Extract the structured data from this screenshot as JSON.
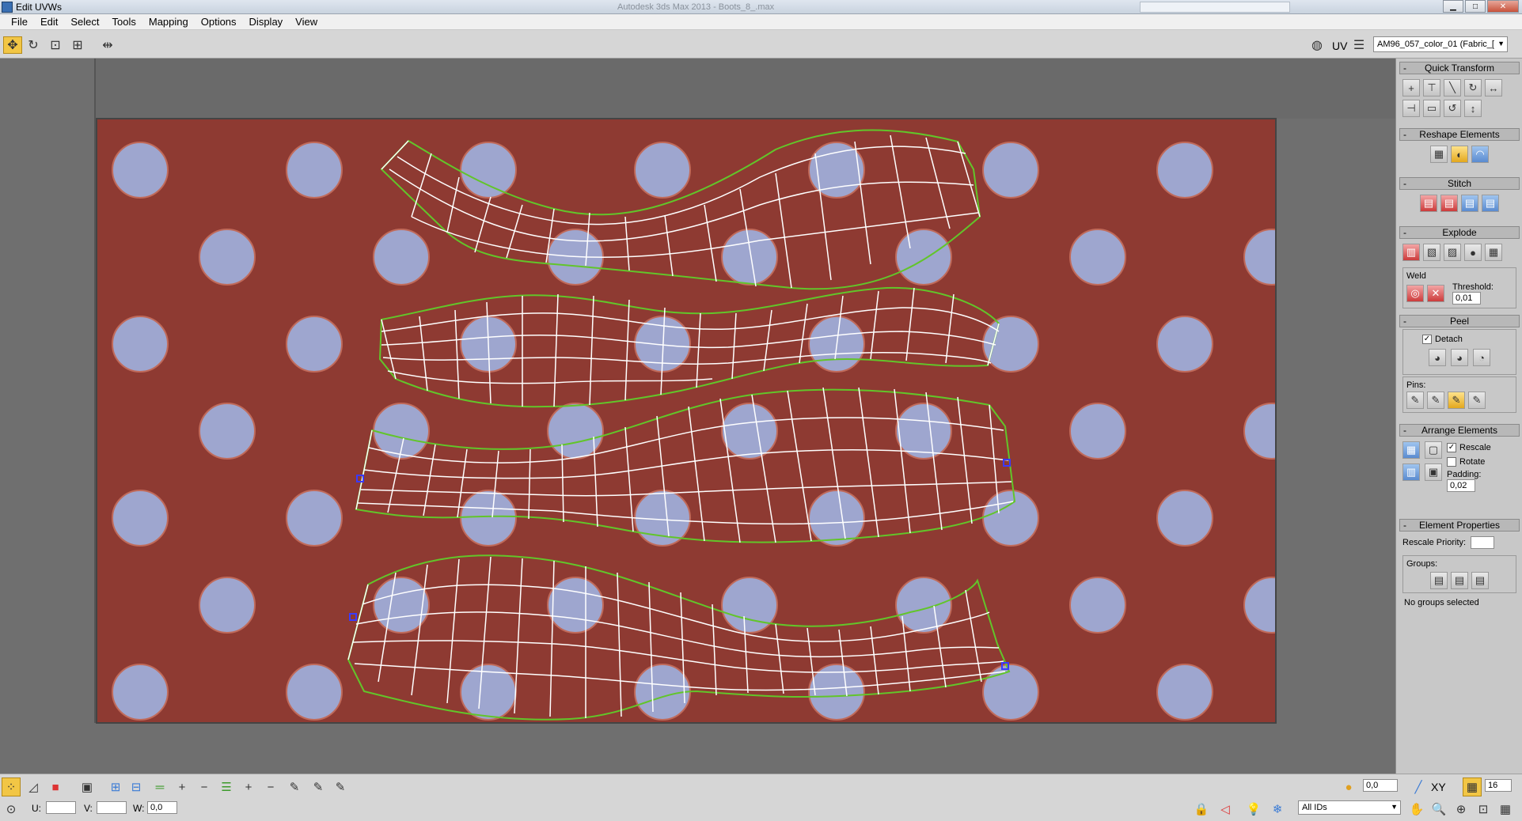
{
  "window": {
    "title": "Edit UVWs",
    "background_title": "Autodesk 3ds Max 2013 - Boots_8_.max",
    "controls": [
      "minimize",
      "maximize",
      "close"
    ]
  },
  "menu": [
    "File",
    "Edit",
    "Select",
    "Tools",
    "Mapping",
    "Options",
    "Display",
    "View"
  ],
  "toolbar": {
    "uv_label": "UV",
    "texture_select": "AM96_057_color_01 (Fabric_["
  },
  "panel": {
    "quick_transform": {
      "title": "Quick Transform"
    },
    "reshape": {
      "title": "Reshape Elements"
    },
    "stitch": {
      "title": "Stitch"
    },
    "explode": {
      "title": "Explode",
      "weld_label": "Weld",
      "threshold_label": "Threshold:",
      "threshold_value": "0,01"
    },
    "peel": {
      "title": "Peel",
      "detach_label": "Detach",
      "pins_label": "Pins:"
    },
    "arrange": {
      "title": "Arrange Elements",
      "rescale_label": "Rescale",
      "rotate_label": "Rotate",
      "padding_label": "Padding:",
      "padding_value": "0,02"
    },
    "element_props": {
      "title": "Element Properties",
      "rescale_priority_label": "Rescale Priority:",
      "groups_label": "Groups:",
      "no_groups": "No groups selected"
    }
  },
  "status": {
    "u_label": "U:",
    "v_label": "V:",
    "w_label": "W:",
    "w_value": "0,0",
    "soft_value": "0,0",
    "xy_label": "XY",
    "grid_value": "16",
    "ids_select": "All IDs"
  },
  "colors": {
    "accent": "#f2c645",
    "fabric": "#8e3a32",
    "dot": "#9ea6cf",
    "seam": "#62c52a",
    "mesh": "#ffffff",
    "pin": "#3a3aff"
  }
}
